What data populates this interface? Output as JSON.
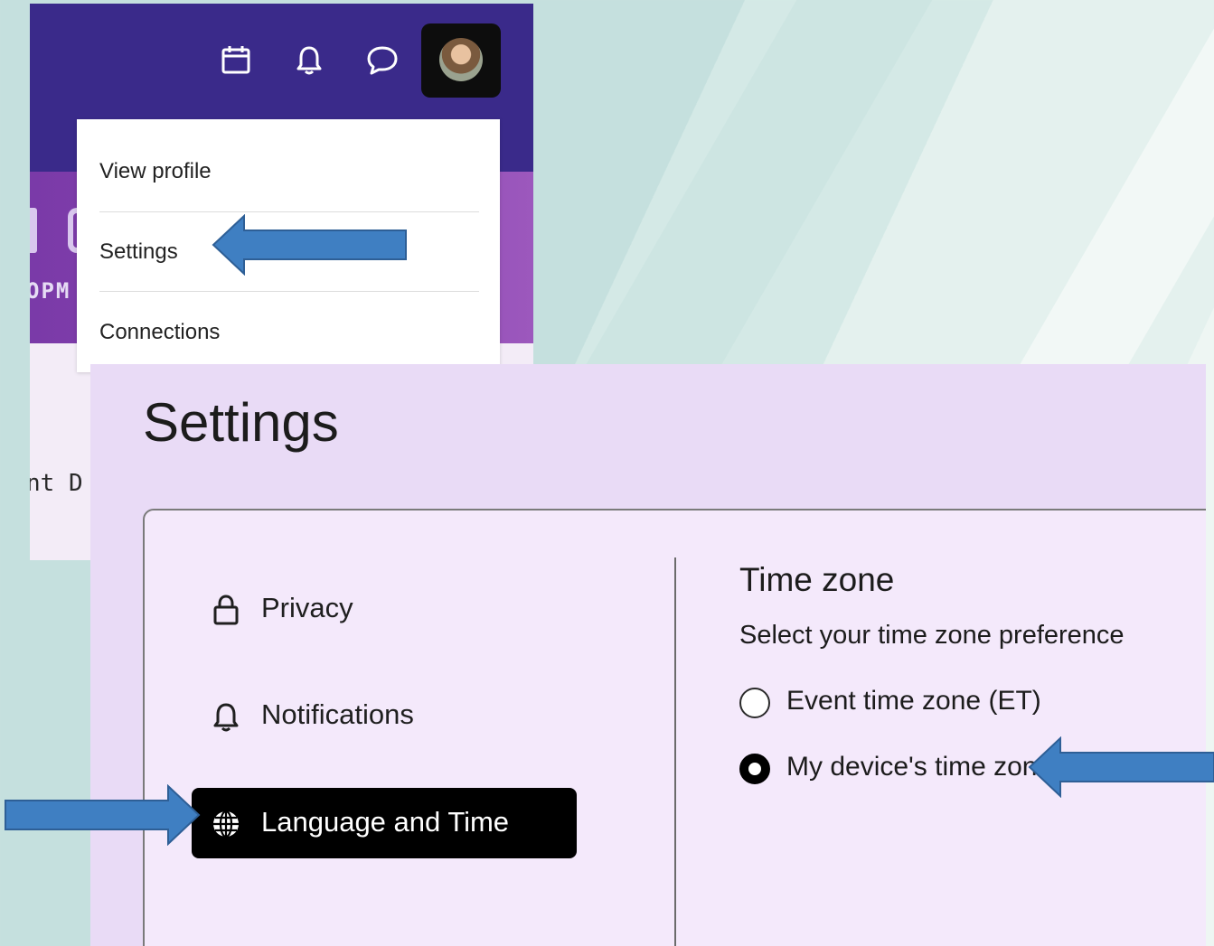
{
  "profile_menu": {
    "items": [
      {
        "label": "View profile"
      },
      {
        "label": "Settings"
      },
      {
        "label": "Connections"
      }
    ],
    "background_fragments": [
      "OPM",
      "nt D"
    ]
  },
  "top_icons": [
    "calendar-icon",
    "bell-icon",
    "chat-icon",
    "avatar"
  ],
  "settings": {
    "title": "Settings",
    "nav": [
      {
        "label": "Privacy",
        "icon": "lock-icon",
        "active": false
      },
      {
        "label": "Notifications",
        "icon": "bell-icon",
        "active": false
      },
      {
        "label": "Language and Time",
        "icon": "globe-icon",
        "active": true
      }
    ],
    "time_zone": {
      "heading": "Time zone",
      "subtitle": "Select your time zone preference",
      "options": [
        {
          "label": "Event time zone (ET)",
          "selected": false
        },
        {
          "label": "My device's time zone",
          "selected": true
        }
      ]
    }
  },
  "colors": {
    "header_bg": "#3a2a8a",
    "hero_bg": "#8b45b0",
    "settings_bg": "#e9dbf6",
    "panel_bg": "#f4e9fb",
    "active_nav_bg": "#000000",
    "arrow": "#3f7fc2",
    "arrow_border": "#2e5f96"
  }
}
